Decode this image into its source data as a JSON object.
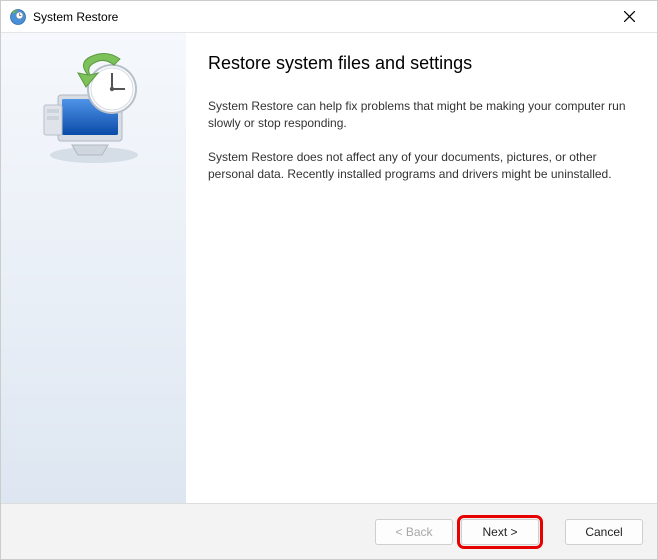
{
  "titlebar": {
    "title": "System Restore"
  },
  "main": {
    "heading": "Restore system files and settings",
    "para1": "System Restore can help fix problems that might be making your computer run slowly or stop responding.",
    "para2": "System Restore does not affect any of your documents, pictures, or other personal data. Recently installed programs and drivers might be uninstalled."
  },
  "footer": {
    "back_label": "< Back",
    "next_label": "Next >",
    "cancel_label": "Cancel"
  }
}
